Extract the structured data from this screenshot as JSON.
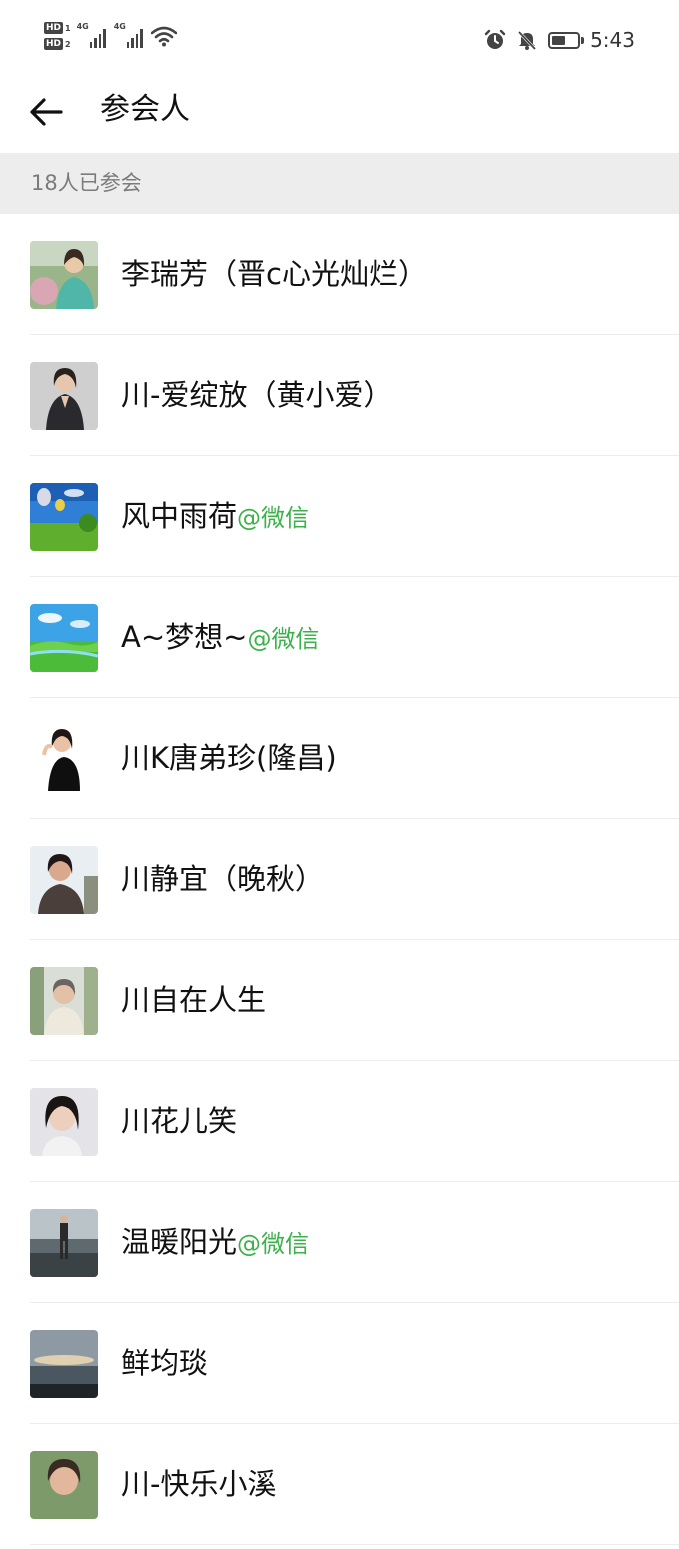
{
  "status_bar": {
    "hd1": "HD",
    "hd1_sub": "1",
    "hd2": "HD",
    "hd2_sub": "2",
    "net1": "4G",
    "net2": "4G",
    "battery_level": 0.55,
    "time": "5:43",
    "icons": [
      "alarm-icon",
      "bell-off-icon",
      "battery-icon",
      "wifi-icon",
      "signal-icon"
    ]
  },
  "header": {
    "title": "参会人",
    "back_icon": "arrow-left-icon"
  },
  "section": {
    "count_label": "18人已参会"
  },
  "participants": [
    {
      "name": "李瑞芳（晋c心光灿烂）",
      "tag": ""
    },
    {
      "name": "川-爱绽放（黄小爱）",
      "tag": ""
    },
    {
      "name": "风中雨荷",
      "tag": "@微信"
    },
    {
      "name": "A~梦想~",
      "tag": "@微信"
    },
    {
      "name": "川K唐弟珍(隆昌)",
      "tag": ""
    },
    {
      "name": "川静宜（晚秋）",
      "tag": ""
    },
    {
      "name": "川自在人生",
      "tag": ""
    },
    {
      "name": "川花儿笑",
      "tag": ""
    },
    {
      "name": "温暖阳光",
      "tag": "@微信"
    },
    {
      "name": "鲜均琰",
      "tag": ""
    },
    {
      "name": "川-快乐小溪",
      "tag": ""
    }
  ],
  "colors": {
    "wechat_tag": "#3cb14a",
    "section_bg": "#ededed",
    "section_text": "#7b7b7b"
  }
}
